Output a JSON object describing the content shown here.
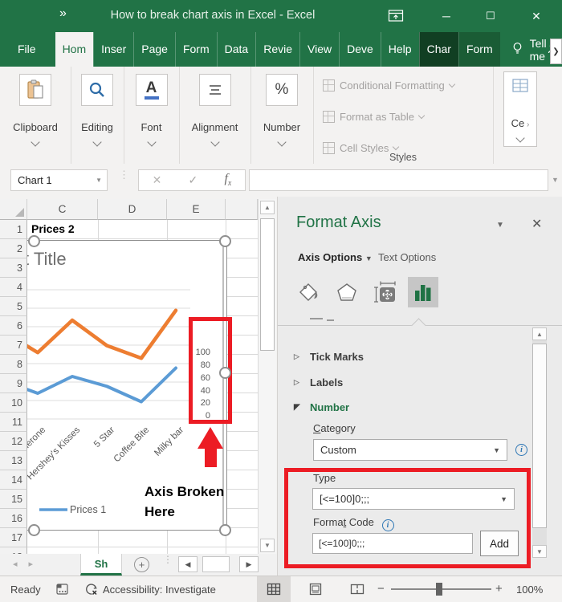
{
  "titlebar": {
    "qat": "»",
    "title": "How to break chart axis in Excel - Excel"
  },
  "ribbon_tabs": [
    {
      "label": "File",
      "style": "file"
    },
    {
      "label": "Hom",
      "style": "selected"
    },
    {
      "label": "Inser",
      "style": "normal"
    },
    {
      "label": "Page",
      "style": "normal"
    },
    {
      "label": "Form",
      "style": "normal"
    },
    {
      "label": "Data",
      "style": "normal"
    },
    {
      "label": "Revie",
      "style": "normal"
    },
    {
      "label": "View",
      "style": "normal"
    },
    {
      "label": "Deve",
      "style": "normal"
    },
    {
      "label": "Help",
      "style": "normal"
    },
    {
      "label": "Char",
      "style": "contextual-dark"
    },
    {
      "label": "Form",
      "style": "contextual"
    }
  ],
  "tell_me": "Tell me",
  "share_label": "Sh",
  "ribbon_groups": [
    {
      "label": "Clipboard",
      "icon": "clipboard-icon"
    },
    {
      "label": "Editing",
      "icon": "magnifier-icon"
    },
    {
      "label": "Font",
      "icon": "font-icon"
    },
    {
      "label": "Alignment",
      "icon": "alignment-icon"
    },
    {
      "label": "Number",
      "icon": "percent-icon"
    }
  ],
  "styles_group": {
    "items": [
      "Conditional Formatting",
      "Format as Table",
      "Cell Styles"
    ],
    "caption": "Styles"
  },
  "cells_group_label": "Ce",
  "formula_bar": {
    "name_box": "Chart 1"
  },
  "worksheet": {
    "columns": [
      "C",
      "D",
      "E"
    ],
    "row_start": 1,
    "row_count": 18,
    "cell_c1": "Prices 2",
    "active_sheet_tab": "Sh"
  },
  "chart": {
    "title_fragment": "t Title",
    "legend_label": "Prices 1",
    "annotation": "Axis Broken Here",
    "axis_values": [
      "100",
      "80",
      "60",
      "40",
      "20",
      "0"
    ],
    "categories": [
      "Toblerone",
      "Hershey's Kisses",
      "5 Star",
      "Coffee Bite",
      "Milky bar"
    ],
    "first_category_clipped": true,
    "highlight_color": "#EC1C24"
  },
  "chart_data": {
    "type": "line",
    "title": "Chart Title (clipped, shows 't Title')",
    "categories": [
      "Toblerone",
      "Hershey's Kisses",
      "5 Star",
      "Coffee Bite",
      "Milky bar"
    ],
    "series": [
      {
        "name": "Prices 2",
        "color": "#ED7D31",
        "values": [
          53,
          76,
          58,
          49,
          83
        ],
        "lead_value": 68
      },
      {
        "name": "Prices 1",
        "color": "#5B9BD5",
        "values": [
          24,
          36,
          29,
          18,
          42
        ],
        "lead_value": 33
      }
    ],
    "ylabels": [
      100,
      80,
      60,
      40,
      20,
      0
    ],
    "ylim": [
      0,
      100
    ],
    "axis_side": "right",
    "axis_broken": true,
    "grid": true,
    "legend_position": "bottom-left",
    "legend_entries": [
      "Prices 1"
    ]
  },
  "format_axis_panel": {
    "title": "Format Axis",
    "tab_axis_options": "Axis Options",
    "tab_text_options": "Text Options",
    "icons": [
      "fill-line-icon",
      "effects-icon",
      "size-properties-icon",
      "axis-chart-icon"
    ],
    "selected_icon": "axis-chart-icon",
    "sections": [
      {
        "label": "Tick Marks",
        "state": "collapsed"
      },
      {
        "label": "Labels",
        "state": "collapsed"
      },
      {
        "label": "Number",
        "state": "expanded"
      }
    ],
    "category_label": "Category",
    "category_value": "Custom",
    "type_label": "Type",
    "type_value": "[<=100]0;;;",
    "format_code_label_pre": "Forma",
    "format_code_accel": "t",
    "format_code_label_post": " Code",
    "format_code_value": "[<=100]0;;;",
    "add_button": "Add"
  },
  "status_bar": {
    "ready": "Ready",
    "accessibility": "Accessibility: Investigate",
    "zoom_level": "100%"
  },
  "colors": {
    "brand_green": "#217346",
    "series_orange": "#ED7D31",
    "series_blue": "#5B9BD5",
    "highlight_red": "#EC1C24"
  }
}
